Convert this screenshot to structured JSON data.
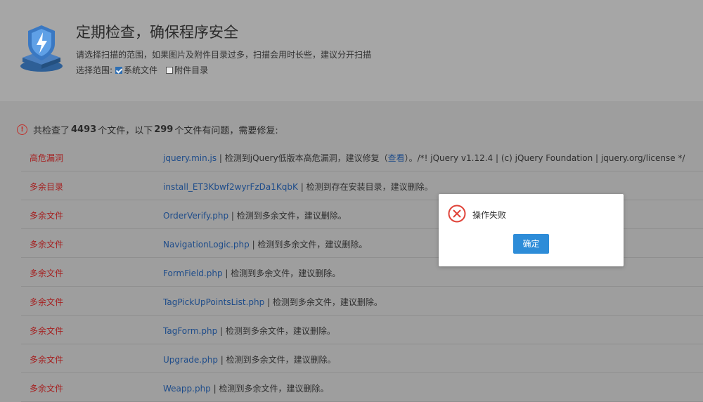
{
  "header": {
    "title": "定期检查，确保程序安全",
    "description": "请选择扫描的范围，如果图片及附件目录过多，扫描会用时长些，建议分开扫描",
    "scope_label": "选择范围:",
    "options": [
      {
        "label": "系统文件",
        "checked": true
      },
      {
        "label": "附件目录",
        "checked": false
      }
    ]
  },
  "summary": {
    "prefix": "共检查了",
    "total": "4493",
    "middle": "个文件，以下",
    "issues": "299",
    "suffix": "个文件有问题，需要修复:"
  },
  "results": [
    {
      "type": "高危漏洞",
      "file": "jquery.min.js",
      "detail": " | 检测到jQuery低版本高危漏洞，建议修复（",
      "link": "查看",
      "extra": "）。/*! jQuery v1.12.4 | (c) jQuery Foundation | jquery.org/license */"
    },
    {
      "type": "多余目录",
      "file": "install_ET3Kbwf2wyrFzDa1KqbK",
      "detail": " | 检测到存在安装目录，建议删除。",
      "link": "",
      "extra": ""
    },
    {
      "type": "多余文件",
      "file": "OrderVerify.php",
      "detail": " | 检测到多余文件，建议删除。",
      "link": "",
      "extra": ""
    },
    {
      "type": "多余文件",
      "file": "NavigationLogic.php",
      "detail": " | 检测到多余文件，建议删除。",
      "link": "",
      "extra": ""
    },
    {
      "type": "多余文件",
      "file": "FormField.php",
      "detail": " | 检测到多余文件，建议删除。",
      "link": "",
      "extra": ""
    },
    {
      "type": "多余文件",
      "file": "TagPickUpPointsList.php",
      "detail": " | 检测到多余文件，建议删除。",
      "link": "",
      "extra": ""
    },
    {
      "type": "多余文件",
      "file": "TagForm.php",
      "detail": " | 检测到多余文件，建议删除。",
      "link": "",
      "extra": ""
    },
    {
      "type": "多余文件",
      "file": "Upgrade.php",
      "detail": " | 检测到多余文件，建议删除。",
      "link": "",
      "extra": ""
    },
    {
      "type": "多余文件",
      "file": "Weapp.php",
      "detail": " | 检测到多余文件，建议删除。",
      "link": "",
      "extra": ""
    }
  ],
  "dialog": {
    "message": "操作失败",
    "confirm_label": "确定"
  },
  "colors": {
    "danger": "#a52020",
    "link": "#1e4c8a",
    "button": "#2d8cd8",
    "error_icon": "#e0443a"
  }
}
